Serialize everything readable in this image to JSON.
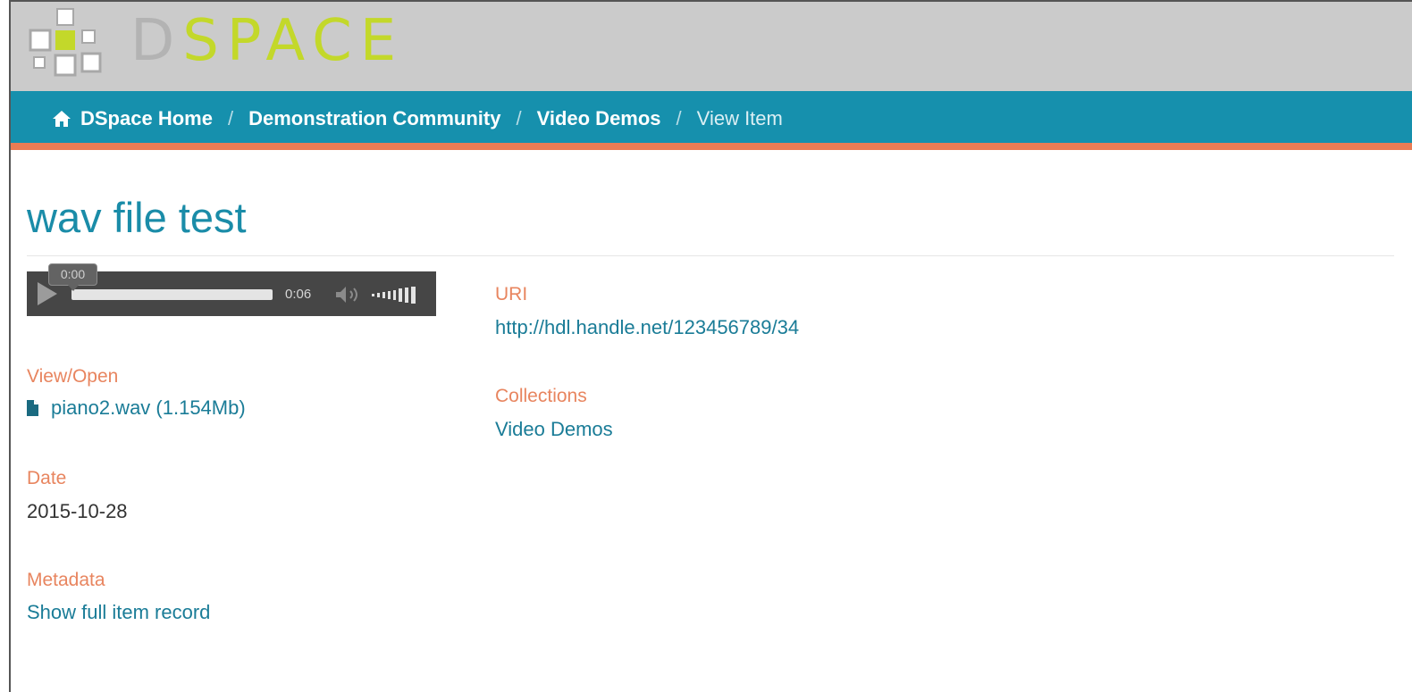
{
  "header": {
    "logo_letter_d": "D",
    "logo_letters_rest": "SPACE",
    "logo_icon": "dspace-logo-icon",
    "colors": {
      "header_bg": "#cbcbcb",
      "logo_grey": "#b3b3b3",
      "logo_green": "#c3d82a"
    }
  },
  "breadcrumb": {
    "home_icon": "home-icon",
    "items": [
      {
        "label": "DSpace Home"
      },
      {
        "label": "Demonstration Community"
      },
      {
        "label": "Video Demos"
      }
    ],
    "separator": "/",
    "current": "View Item",
    "colors": {
      "bar_bg": "#1690ad",
      "accent_border": "#ea7c54"
    }
  },
  "item": {
    "title": "wav file test"
  },
  "player": {
    "current_time": "0:00",
    "duration": "0:06",
    "progress_fraction": 0.0,
    "play_icon": "play-icon",
    "mute_icon": "speaker-icon",
    "volume_icon": "volume-bars-icon"
  },
  "fields": {
    "view_open": {
      "label": "View/Open",
      "file_icon": "file-icon",
      "file_link": "piano2.wav (1.154Mb)"
    },
    "date": {
      "label": "Date",
      "value": "2015-10-28"
    },
    "metadata": {
      "label": "Metadata",
      "link": "Show full item record"
    },
    "uri": {
      "label": "URI",
      "value": "http://hdl.handle.net/123456789/34"
    },
    "collections": {
      "label": "Collections",
      "value": "Video Demos"
    }
  },
  "colors": {
    "title": "#1a8ca8",
    "label": "#e8855f",
    "link": "#1a7c97"
  }
}
